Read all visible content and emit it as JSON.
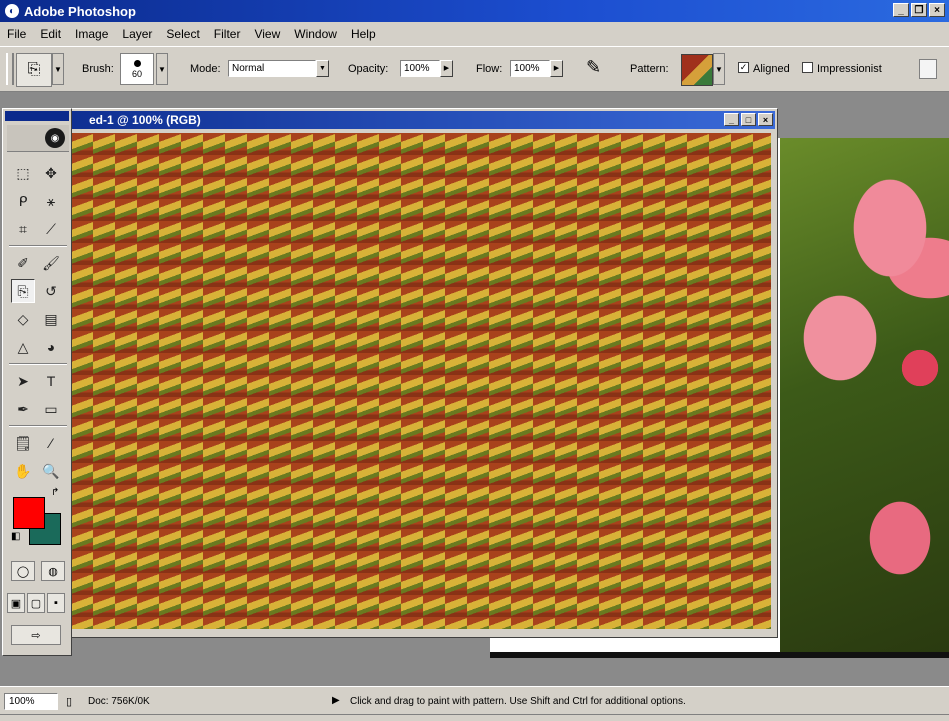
{
  "window": {
    "title": "Adobe Photoshop"
  },
  "menu": [
    "File",
    "Edit",
    "Image",
    "Layer",
    "Select",
    "Filter",
    "View",
    "Window",
    "Help"
  ],
  "options": {
    "brush_label": "Brush:",
    "brush_size": "60",
    "mode_label": "Mode:",
    "mode_value": "Normal",
    "opacity_label": "Opacity:",
    "opacity_value": "100%",
    "flow_label": "Flow:",
    "flow_value": "100%",
    "pattern_label": "Pattern:",
    "aligned_label": "Aligned",
    "aligned_checked": true,
    "impressionist_label": "Impressionist",
    "impressionist_checked": false
  },
  "document": {
    "title": "ed-1 @ 100% (RGB)"
  },
  "colors": {
    "foreground": "#ff0000",
    "background": "#1a6a5a",
    "title_bar": "#0b2a8c"
  },
  "status": {
    "zoom": "100%",
    "doc_info": "Doc: 756K/0K",
    "hint": "Click and drag to paint with pattern.  Use Shift and Ctrl for additional options."
  }
}
